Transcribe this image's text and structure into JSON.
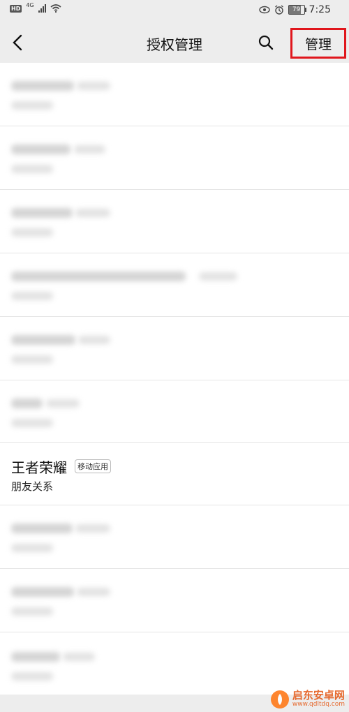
{
  "status_bar": {
    "hd": "HD",
    "network": "4G",
    "battery": "79",
    "time": "7:25"
  },
  "nav": {
    "title": "授权管理",
    "manage_label": "管理",
    "back_icon": "chevron-left-icon",
    "search_icon": "search-icon"
  },
  "highlight_item": {
    "name": "王者荣耀",
    "badge": "移动应用",
    "permission": "朋友关系"
  },
  "watermark": {
    "main": "启东安卓网",
    "sub": "www.qdltdq.com"
  },
  "colors": {
    "highlight_border": "#e0161c",
    "background": "#ededed",
    "list_background": "#ffffff",
    "watermark": "#e55b1a"
  }
}
